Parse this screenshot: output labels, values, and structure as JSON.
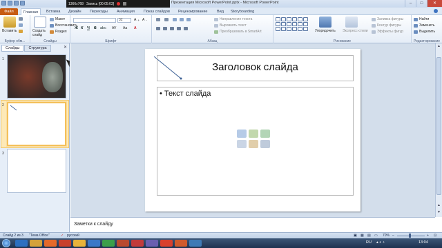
{
  "titlebar": {
    "recorder_resolution": "1366x768",
    "recorder_status": "Запись [00:05:03]",
    "app_title": "Презентация Microsoft PowerPoint.pptx - Microsoft PowerPoint"
  },
  "tabs": [
    "Файл",
    "Главная",
    "Вставка",
    "Дизайн",
    "Переходы",
    "Анимация",
    "Показ слайдов",
    "Рецензирование",
    "Вид",
    "Storyboarding"
  ],
  "ribbon": {
    "clipboard": {
      "paste": "Вставить",
      "label": "Буфер обм..."
    },
    "slides": {
      "new_slide": "Создать слайд",
      "layout": "Макет",
      "reset": "Восстановить",
      "section": "Раздел",
      "label": "Слайды"
    },
    "font": {
      "font_name": "",
      "font_size": "32",
      "label": "Шрифт",
      "bold": "Ж",
      "italic": "К",
      "underline": "Ч",
      "strike": "S",
      "shadow": "abc"
    },
    "paragraph": {
      "text_direction": "Направление текста",
      "align_text": "Выровнять текст",
      "smartart": "Преобразовать в SmartArt",
      "label": "Абзац"
    },
    "drawing": {
      "arrange": "Упорядочить",
      "quick_styles": "Экспресс-стили",
      "shape_fill": "Заливка фигуры",
      "shape_outline": "Контур фигуры",
      "shape_effects": "Эффекты фигур",
      "label": "Рисование"
    },
    "editing": {
      "find": "Найти",
      "replace": "Заменить",
      "select": "Выделить",
      "label": "Редактирование"
    }
  },
  "left_panel": {
    "tab_slides": "Слайды",
    "tab_outline": "Структура",
    "slide_numbers": [
      "1",
      "2",
      "3"
    ]
  },
  "slide": {
    "title": "Заголовок слайда",
    "bullet": "Текст слайда"
  },
  "notes": {
    "placeholder": "Заметки к слайду"
  },
  "statusbar": {
    "slide_counter": "Слайд 2 из 3",
    "theme": "\"Тема Office\"",
    "language": "русский",
    "zoom": "70%"
  },
  "taskbar": {
    "lang": "RU",
    "time": "13:04"
  },
  "colors": {
    "file_tab": "#c75b12",
    "ribbon_bg": "#e5edf7",
    "workspace_bg": "#d3deeb",
    "selection": "#f4c05a",
    "taskbar": "#1e3250"
  }
}
